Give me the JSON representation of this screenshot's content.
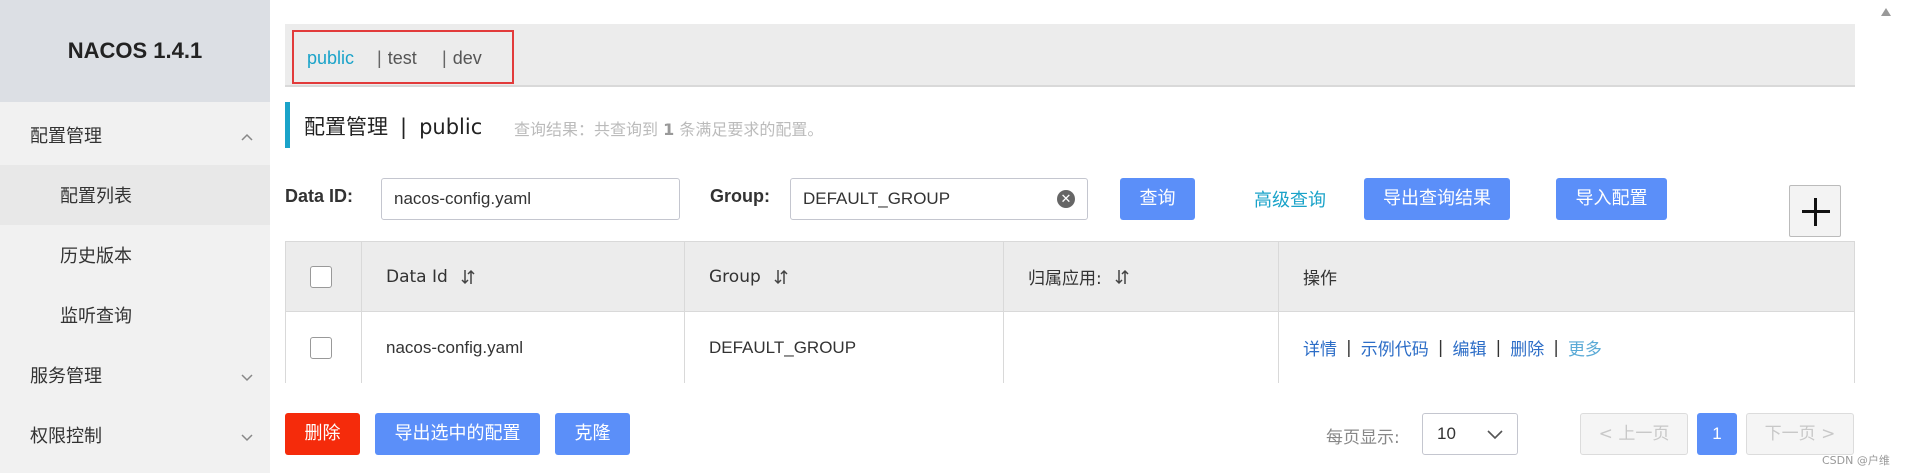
{
  "app": {
    "title": "NACOS 1.4.1"
  },
  "sidebar": {
    "items": [
      {
        "label": "配置管理",
        "level": "top",
        "expanded": true
      },
      {
        "label": "配置列表",
        "level": "sub",
        "active": true
      },
      {
        "label": "历史版本",
        "level": "sub"
      },
      {
        "label": "监听查询",
        "level": "sub"
      },
      {
        "label": "服务管理",
        "level": "top",
        "expanded": false
      },
      {
        "label": "权限控制",
        "level": "top",
        "expanded": false
      }
    ]
  },
  "namespaces": {
    "items": [
      "public",
      "test",
      "dev"
    ],
    "separator": "|",
    "active": "public"
  },
  "page": {
    "title": "配置管理",
    "separator": "|",
    "namespace": "public",
    "result_prefix": "查询结果：共查询到",
    "result_count": "1",
    "result_suffix": "条满足要求的配置。"
  },
  "search": {
    "data_id_label": "Data ID:",
    "data_id_value": "nacos-config.yaml",
    "group_label": "Group:",
    "group_value": "DEFAULT_GROUP",
    "query_button": "查询",
    "advanced_link": "高级查询",
    "export_results_button": "导出查询结果",
    "import_button": "导入配置"
  },
  "table": {
    "columns": [
      "Data Id",
      "Group",
      "归属应用:",
      "操作"
    ],
    "rows": [
      {
        "data_id": "nacos-config.yaml",
        "group": "DEFAULT_GROUP",
        "app": "",
        "actions": [
          "详情",
          "示例代码",
          "编辑",
          "删除",
          "更多"
        ]
      }
    ]
  },
  "footer": {
    "delete_button": "删除",
    "export_selected_button": "导出选中的配置",
    "clone_button": "克隆",
    "per_page_label": "每页显示:",
    "per_page_value": "10",
    "prev_button": "上一页",
    "current_page": "1",
    "next_button": "下一页"
  },
  "watermark": "CSDN @户维",
  "colors": {
    "accent": "#1aa3c9",
    "primary": "#5b8ff9",
    "danger": "#f52b0b",
    "highlight_box": "#e23b3b"
  }
}
